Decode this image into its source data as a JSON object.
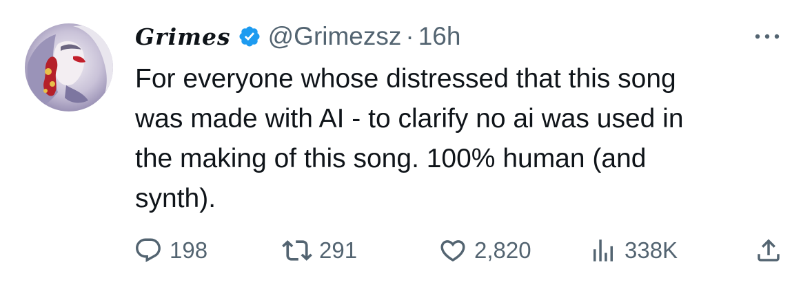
{
  "tweet": {
    "author": {
      "display_name": "Grimes",
      "handle": "@Grimezsz",
      "verified": true,
      "avatar_icon": "avatar-image"
    },
    "separator": "·",
    "time": "16h",
    "more_icon": "more-horizontal-icon",
    "text": "For everyone whose distressed that this song\nwas made with AI - to clarify no ai was used in\nthe making of this song.  100% human (and\nsynth).",
    "actions": {
      "reply": {
        "icon": "reply-icon",
        "count": "198"
      },
      "retweet": {
        "icon": "retweet-icon",
        "count": "291"
      },
      "like": {
        "icon": "heart-icon",
        "count": "2,820"
      },
      "views": {
        "icon": "views-icon",
        "count": "338K"
      },
      "share": {
        "icon": "share-icon"
      }
    }
  },
  "colors": {
    "text_primary": "#0f1419",
    "text_secondary": "#536471",
    "verified_blue": "#1d9bf0",
    "background": "#ffffff"
  }
}
